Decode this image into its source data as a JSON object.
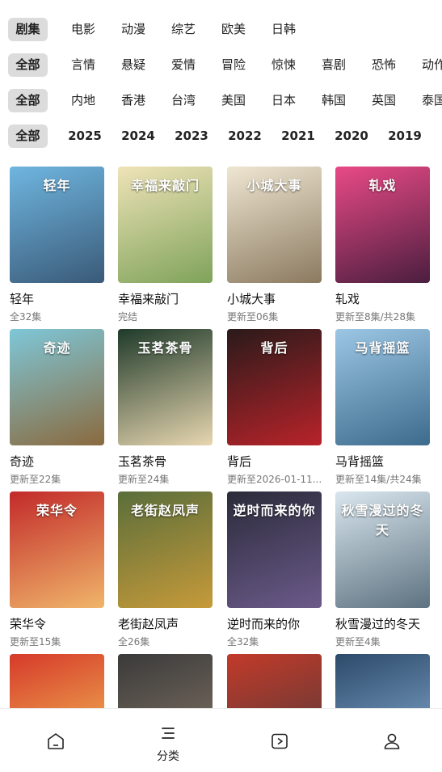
{
  "filters": {
    "category": [
      "剧集",
      "电影",
      "动漫",
      "综艺",
      "欧美",
      "日韩"
    ],
    "genre": [
      "全部",
      "言情",
      "悬疑",
      "爱情",
      "冒险",
      "惊悚",
      "喜剧",
      "恐怖",
      "动作"
    ],
    "region": [
      "全部",
      "内地",
      "香港",
      "台湾",
      "美国",
      "日本",
      "韩国",
      "英国",
      "泰国"
    ],
    "year": [
      "全部",
      "2025",
      "2024",
      "2023",
      "2022",
      "2021",
      "2020",
      "2019"
    ]
  },
  "shows": [
    {
      "title": "轻年",
      "sub": "全32集",
      "poster_text": "轻年",
      "colors": [
        "#6fb6e0",
        "#3a5a78"
      ]
    },
    {
      "title": "幸福来敲门",
      "sub": "完结",
      "poster_text": "幸福来敲门",
      "colors": [
        "#efe3b8",
        "#7fa35a"
      ]
    },
    {
      "title": "小城大事",
      "sub": "更新至06集",
      "poster_text": "小城大事",
      "colors": [
        "#efe6d2",
        "#8b7a60"
      ]
    },
    {
      "title": "轧戏",
      "sub": "更新至8集/共28集",
      "poster_text": "轧戏",
      "colors": [
        "#e94a86",
        "#4b1e3f"
      ]
    },
    {
      "title": "奇迹",
      "sub": "更新至22集",
      "poster_text": "奇迹",
      "colors": [
        "#7ec7d8",
        "#8a6a3e"
      ]
    },
    {
      "title": "玉茗茶骨",
      "sub": "更新至24集",
      "poster_text": "玉茗茶骨",
      "colors": [
        "#1f3a2a",
        "#e7d6b0"
      ]
    },
    {
      "title": "背后",
      "sub": "更新至2026-01-11...",
      "poster_text": "背后",
      "colors": [
        "#2a1a1a",
        "#b8232a"
      ]
    },
    {
      "title": "马背摇篮",
      "sub": "更新至14集/共24集",
      "poster_text": "马背摇篮",
      "colors": [
        "#9cc6e4",
        "#3d6b8c"
      ]
    },
    {
      "title": "荣华令",
      "sub": "更新至15集",
      "poster_text": "荣华令",
      "colors": [
        "#c22a2a",
        "#f0b56a"
      ]
    },
    {
      "title": "老街赵凤声",
      "sub": "全26集",
      "poster_text": "老街赵凤声",
      "colors": [
        "#5a6e3a",
        "#c69a3a"
      ]
    },
    {
      "title": "逆时而来的你",
      "sub": "全32集",
      "poster_text": "逆时而来的你",
      "colors": [
        "#2b2b3a",
        "#6b5a8a"
      ]
    },
    {
      "title": "秋雪漫过的冬天",
      "sub": "更新至4集",
      "poster_text": "秋雪漫过的冬天",
      "colors": [
        "#d9e6ee",
        "#5d7280"
      ]
    },
    {
      "title": "",
      "sub": "",
      "poster_text": "",
      "colors": [
        "#d63a2a",
        "#f4c65a"
      ]
    },
    {
      "title": "",
      "sub": "",
      "poster_text": "",
      "colors": [
        "#3a3a3a",
        "#8a7a6a"
      ]
    },
    {
      "title": "",
      "sub": "",
      "poster_text": "",
      "colors": [
        "#c23a2a",
        "#4a3a3a"
      ]
    },
    {
      "title": "",
      "sub": "",
      "poster_text": "",
      "colors": [
        "#2d4a6a",
        "#8ab2d8"
      ]
    }
  ],
  "tabbar": {
    "items": [
      {
        "icon": "home-icon",
        "label": ""
      },
      {
        "icon": "category-menu-icon",
        "label": "分类"
      },
      {
        "icon": "play-icon",
        "label": ""
      },
      {
        "icon": "profile-icon",
        "label": ""
      }
    ]
  }
}
